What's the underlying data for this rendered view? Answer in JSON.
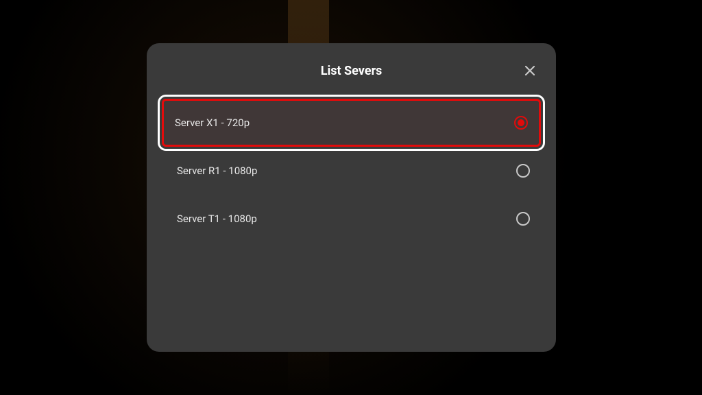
{
  "dialog": {
    "title": "List Severs",
    "servers": [
      {
        "label": "Server X1 - 720p",
        "selected": true,
        "focused": true
      },
      {
        "label": "Server R1 - 1080p",
        "selected": false,
        "focused": false
      },
      {
        "label": "Server T1 - 1080p",
        "selected": false,
        "focused": false
      }
    ]
  },
  "colors": {
    "accent": "#e30b0b",
    "dialog_bg": "#3a3a3a"
  }
}
